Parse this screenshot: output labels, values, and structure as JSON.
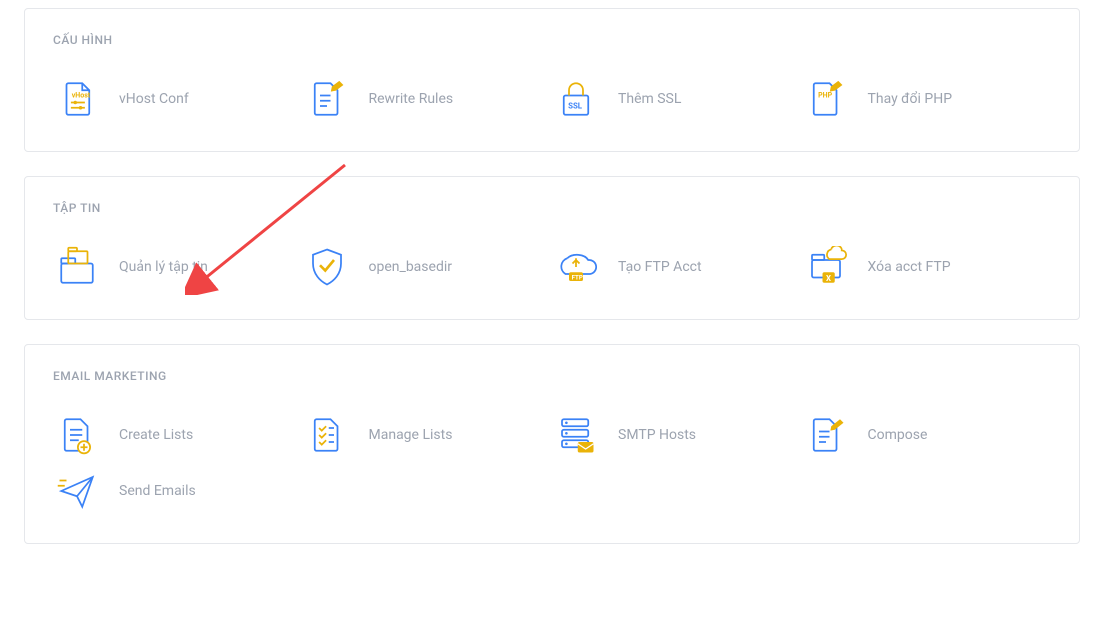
{
  "panels": [
    {
      "title": "CẤU HÌNH",
      "items": [
        {
          "label": "vHost Conf",
          "icon": "vhost-conf-icon"
        },
        {
          "label": "Rewrite Rules",
          "icon": "rewrite-rules-icon"
        },
        {
          "label": "Thêm SSL",
          "icon": "ssl-icon"
        },
        {
          "label": "Thay đổi PHP",
          "icon": "php-icon"
        }
      ]
    },
    {
      "title": "TẬP TIN",
      "items": [
        {
          "label": "Quản lý tập tin",
          "icon": "file-manager-icon"
        },
        {
          "label": "open_basedir",
          "icon": "open-basedir-icon"
        },
        {
          "label": "Tạo FTP Acct",
          "icon": "ftp-create-icon"
        },
        {
          "label": "Xóa acct FTP",
          "icon": "ftp-delete-icon"
        }
      ]
    },
    {
      "title": "EMAIL MARKETING",
      "items": [
        {
          "label": "Create Lists",
          "icon": "create-lists-icon"
        },
        {
          "label": "Manage Lists",
          "icon": "manage-lists-icon"
        },
        {
          "label": "SMTP Hosts",
          "icon": "smtp-hosts-icon"
        },
        {
          "label": "Compose",
          "icon": "compose-icon"
        },
        {
          "label": "Send Emails",
          "icon": "send-emails-icon"
        }
      ]
    }
  ],
  "colors": {
    "blue": "#3b82f6",
    "lightBlue": "#60a5fa",
    "olive": "#eab308",
    "darkOlive": "#a3a635",
    "grey": "#9ca3af",
    "border": "#e5e7eb",
    "arrow": "#ef4444"
  }
}
